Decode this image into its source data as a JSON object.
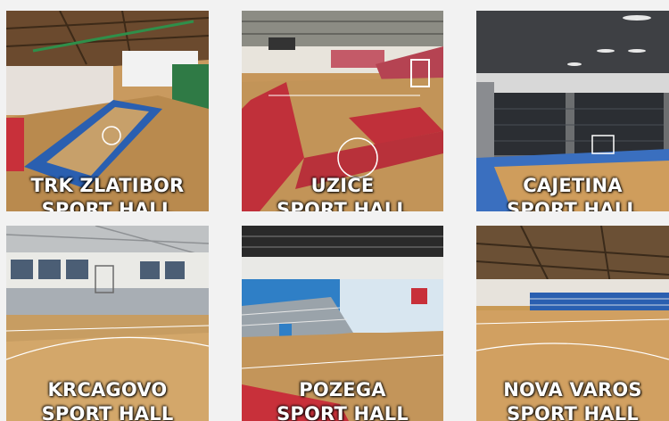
{
  "halls": [
    {
      "line1": "TRK ZLATIBOR",
      "line2": "SPORT HALL"
    },
    {
      "line1": "UZICE",
      "line2": "SPORT HALL"
    },
    {
      "line1": "CAJETINA",
      "line2": "SPORT HALL"
    },
    {
      "line1": "KRCAGOVO",
      "line2": "SPORT HALL"
    },
    {
      "line1": "POZEGA",
      "line2": "SPORT HALL"
    },
    {
      "line1": "NOVA VAROS",
      "line2": "SPORT HALL"
    }
  ],
  "colors": {
    "background": "#f2f2f2",
    "caption_text": "#ffffff",
    "wood_floor": "#b98a4e",
    "court_blue": "#2a5fb0",
    "court_red": "#c8303a"
  }
}
